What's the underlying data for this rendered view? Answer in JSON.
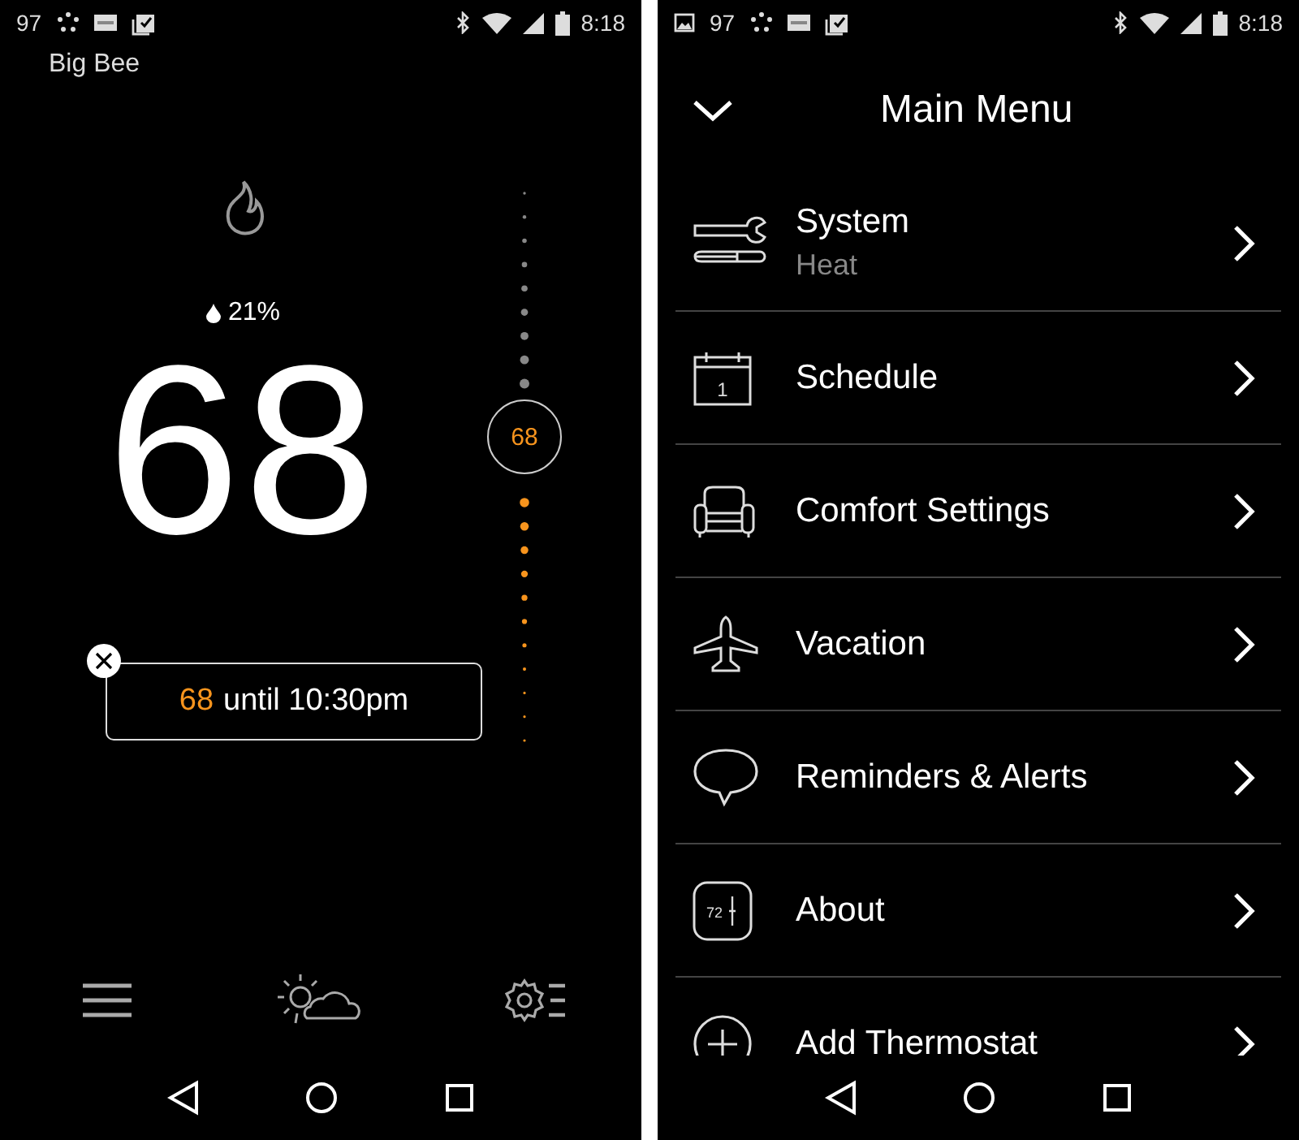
{
  "left_screen": {
    "status_bar": {
      "notifications": [
        {
          "kind": "count",
          "text": "97"
        },
        {
          "kind": "dots"
        },
        {
          "kind": "sonos"
        },
        {
          "kind": "clipboard"
        }
      ],
      "time": "8:18"
    },
    "thermostat_name": "Big Bee",
    "humidity": "21%",
    "temperature": "68",
    "setpoint_dial": {
      "setpoint": "68",
      "level": 0.55
    },
    "hold": {
      "setpoint": "68",
      "text": "until 10:30pm"
    }
  },
  "right_screen": {
    "status_bar": {
      "notifications": [
        {
          "kind": "image"
        },
        {
          "kind": "count",
          "text": "97"
        },
        {
          "kind": "dots"
        },
        {
          "kind": "sonos"
        },
        {
          "kind": "clipboard"
        }
      ],
      "time": "8:18"
    },
    "title": "Main Menu",
    "menu_items": [
      {
        "kind": "system",
        "label": "System",
        "subtitle": "Heat"
      },
      {
        "kind": "schedule",
        "label": "Schedule",
        "icon_text": "1"
      },
      {
        "kind": "comfort",
        "label": "Comfort Settings"
      },
      {
        "kind": "vacation",
        "label": "Vacation"
      },
      {
        "kind": "reminders",
        "label": "Reminders & Alerts"
      },
      {
        "kind": "about",
        "label": "About",
        "icon_text": "72"
      },
      {
        "kind": "add",
        "label": "Add Thermostat"
      }
    ]
  }
}
